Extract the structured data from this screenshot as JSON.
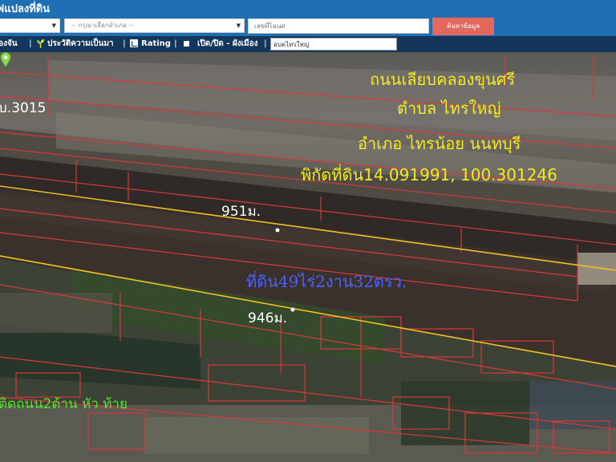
{
  "app": {
    "title": "ฟแปลงที่ดิน"
  },
  "search": {
    "province_value": "",
    "district_placeholder": "-- กรุณาเลือกอำเภอ --",
    "parcel_placeholder": "เลขที่โฉนด",
    "submit_label": "ค้นหาข้อมูล"
  },
  "toolbar": {
    "items": [
      {
        "label": "องจัน"
      },
      {
        "label": "ประวัติความเป็นมา"
      },
      {
        "label": "Rating"
      },
      {
        "label": "เปิด/ปิด - ผังเมือง"
      }
    ],
    "place_value": "อบตไทรใหญ่"
  },
  "map": {
    "road": "ถนนเลียบคลองขุนศรี",
    "subdistrict": "ตำบล  ไทรใหญ่",
    "district": "อำเภอ  ไทรน้อย  นนทบุรี",
    "coordinates": "พิกัดที่ดิน14.091991, 100.301246",
    "parcel_number": "บ.3015",
    "top_distance": "951ม.",
    "bottom_distance": "946ม.",
    "area": "ที่ดิน49ไร่2งาน32ตรว.",
    "frontage": "ติดถนน2ด้าน หัว ท้าย"
  },
  "colors": {
    "header_bg": "#1f6fb5",
    "toolbar_bg": "#14365a",
    "search_button": "#e4685c",
    "label_yellow": "#f2ea1e",
    "area_label": "#4a62ff",
    "frontage_label": "#58e02e",
    "parcel_line": "#d63a3a",
    "boundary_line": "#f0c020"
  },
  "icons": {
    "history": "sprout-icon",
    "rating": "chart-icon",
    "zoning": "square-toggle-icon",
    "marker": "map-pin-icon"
  }
}
